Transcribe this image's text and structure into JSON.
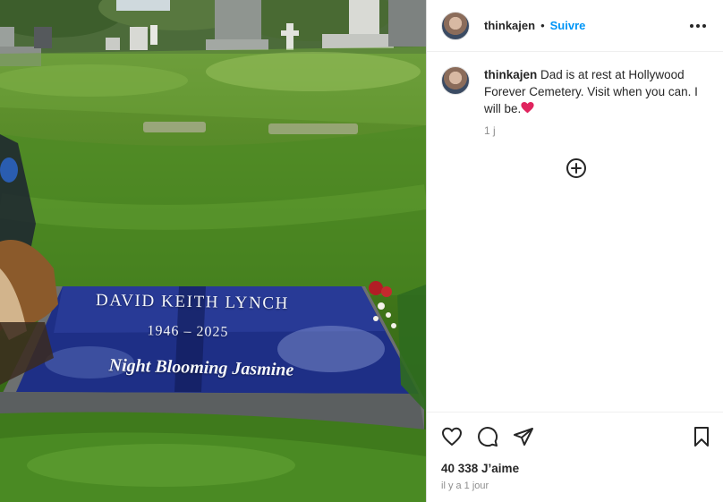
{
  "post": {
    "username": "thinkajen",
    "follow_label": "Suivre",
    "header_separator": "•"
  },
  "photo": {
    "plaque_name": "DAVID KEITH LYNCH",
    "plaque_years": "1946 – 2025",
    "plaque_epitaph": "Night Blooming Jasmine"
  },
  "caption": {
    "username": "thinkajen",
    "text": "Dad is at rest at Hollywood Forever Cemetery. Visit when you can. I will be.",
    "emoji_name": "red-heart-icon",
    "time": "1 j"
  },
  "footer": {
    "likes": "40 338 J’aime",
    "date": "il y a 1 jour"
  },
  "colors": {
    "link_blue": "#0095f6",
    "text": "#262626",
    "muted": "#8e8e8e",
    "heart_red": "#e0245e"
  },
  "icons": [
    "more-options-icon",
    "add-comment-icon",
    "like-heart-icon",
    "comment-icon",
    "share-icon",
    "save-bookmark-icon"
  ]
}
